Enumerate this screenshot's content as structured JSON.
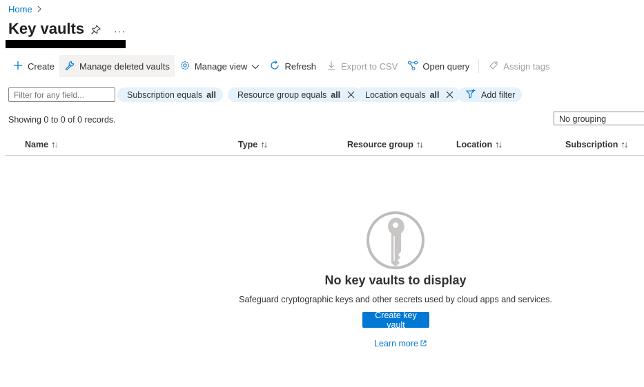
{
  "breadcrumb": {
    "home": "Home",
    "separator": ">"
  },
  "page": {
    "title": "Key vaults",
    "more": "···"
  },
  "toolbar": {
    "create": "Create",
    "manage_deleted": "Manage deleted vaults",
    "manage_view": "Manage view",
    "refresh": "Refresh",
    "export_csv": "Export to CSV",
    "open_query": "Open query",
    "assign_tags": "Assign tags"
  },
  "filters": {
    "placeholder": "Filter for any field...",
    "subscription": {
      "label": "Subscription equals",
      "value": "all"
    },
    "resource_group": {
      "label": "Resource group equals",
      "value": "all"
    },
    "location": {
      "label": "Location equals",
      "value": "all"
    },
    "add_filter": "Add filter"
  },
  "records_text": "Showing 0 to 0 of 0 records.",
  "grouping": "No grouping",
  "columns": [
    "Name",
    "Type",
    "Resource group",
    "Location",
    "Subscription"
  ],
  "sort_glyph": "↑↓",
  "empty_state": {
    "title": "No key vaults to display",
    "description": "Safeguard cryptographic keys and other secrets used by cloud apps and services.",
    "button": "Create key vault",
    "link": "Learn more"
  },
  "icons": {
    "pin": "pin-icon",
    "create": "plus-icon",
    "manage_deleted": "wrench-icon",
    "manage_view": "gear-icon",
    "refresh": "refresh-icon",
    "export": "download-icon",
    "query": "query-icon",
    "tags": "tag-icon",
    "add_filter": "filter-add-icon",
    "empty": "key-icon",
    "external": "external-link-icon"
  },
  "colors": {
    "accent": "#0078d4",
    "pill_bg": "#e5f1fb",
    "disabled": "#a19f9d"
  }
}
